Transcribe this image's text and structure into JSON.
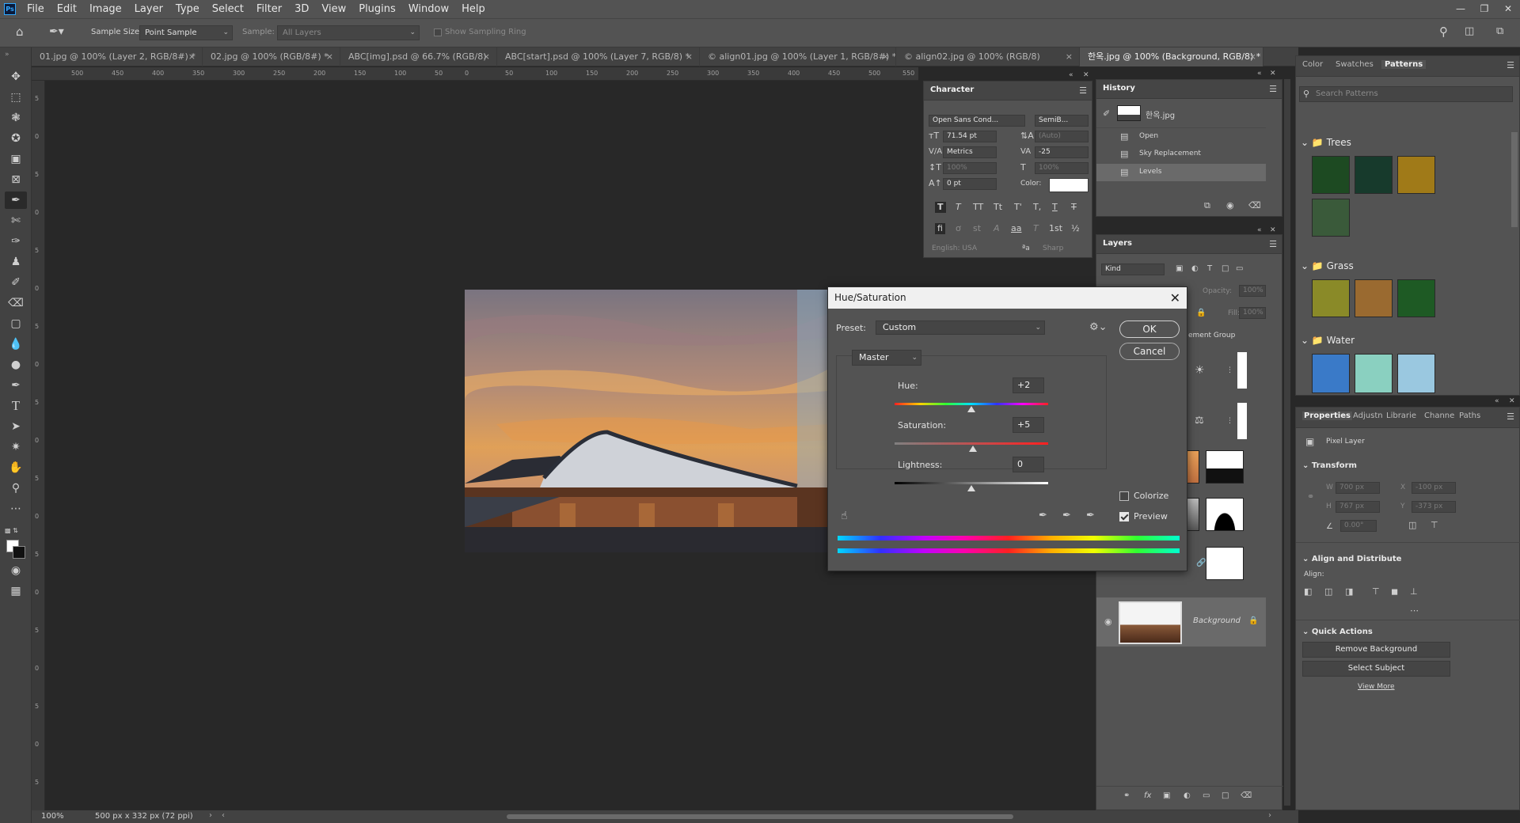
{
  "app": {
    "logo": "Ps",
    "menu": [
      "File",
      "Edit",
      "Image",
      "Layer",
      "Type",
      "Select",
      "Filter",
      "3D",
      "View",
      "Plugins",
      "Window",
      "Help"
    ]
  },
  "options": {
    "sample_size_label": "Sample Size:",
    "sample_size_value": "Point Sample",
    "sample_label": "Sample:",
    "sample_value": "All Layers",
    "show_ring": "Show Sampling Ring"
  },
  "tabs": [
    "01.jpg @ 100% (Layer 2, RGB/8#) *",
    "02.jpg @ 100% (RGB/8#) *",
    "ABC[img].psd @ 66.7% (RGB/8)",
    "ABC[start].psd @ 100% (Layer 7, RGB/8) *",
    "© align01.jpg @ 100% (Layer 1, RGB/8#) *",
    "© align02.jpg @ 100% (RGB/8)",
    "한옥.jpg @ 100% (Background, RGB/8) *"
  ],
  "ruler": {
    "h": [
      "500",
      "450",
      "400",
      "350",
      "300",
      "250",
      "200",
      "150",
      "100",
      "50",
      "0",
      "50",
      "100",
      "150",
      "200",
      "250",
      "300",
      "350",
      "400",
      "450",
      "500",
      "550"
    ],
    "v": [
      "5",
      "0",
      "5",
      "0",
      "5",
      "0",
      "5",
      "0",
      "5",
      "0",
      "5",
      "0",
      "5",
      "0",
      "5",
      "0",
      "5",
      "0",
      "5"
    ]
  },
  "status": {
    "zoom": "100%",
    "doc": "500 px x 332 px (72 ppi)"
  },
  "character": {
    "title": "Character",
    "font": "Open Sans Cond...",
    "style": "SemiB...",
    "size": "71.54 pt",
    "leading": "(Auto)",
    "kerning": "Metrics",
    "tracking": "-25",
    "vscale": "100%",
    "hscale": "100%",
    "baseline": "0 pt",
    "color_label": "Color:",
    "lang": "English: USA",
    "aa": "Sharp",
    "style_buttons": [
      "T",
      "T",
      "TT",
      "Tt",
      "T'",
      "T,",
      "T",
      "T"
    ],
    "ot_buttons": [
      "fi",
      "ơ",
      "st",
      "A",
      "aa",
      "T",
      "1st",
      "½"
    ]
  },
  "history": {
    "title": "History",
    "snapshot": "한옥.jpg",
    "items": [
      "Open",
      "Sky Replacement",
      "Levels"
    ]
  },
  "layers": {
    "title": "Layers",
    "kind": "Kind",
    "opacity_label": "Opacity:",
    "opacity": "100%",
    "fill_label": "Fill:",
    "fill": "100%",
    "group_name": "ement Group",
    "background": "Background"
  },
  "patterns": {
    "tabs": [
      "Color",
      "Swatches",
      "Patterns"
    ],
    "search": "Search Patterns",
    "groups": [
      {
        "name": "Trees",
        "colors": [
          "#1d4a22",
          "#173a2c",
          "#a07a18",
          "#3a5a3a"
        ]
      },
      {
        "name": "Grass",
        "colors": [
          "#8a8a28",
          "#9a6a30",
          "#1e5a24"
        ]
      },
      {
        "name": "Water",
        "colors": [
          "#3a7ac8",
          "#8ad0c0",
          "#9ac8e0"
        ]
      }
    ]
  },
  "properties": {
    "tabs": [
      "Properties",
      "Adjustn",
      "Librarie",
      "Channe",
      "Paths"
    ],
    "type": "Pixel Layer",
    "transform": "Transform",
    "w_label": "W",
    "w": "700 px",
    "h_label": "H",
    "h": "767 px",
    "x_label": "X",
    "x": "-100 px",
    "y_label": "Y",
    "y": "-373 px",
    "angle": "0.00°",
    "align_title": "Align and Distribute",
    "align_label": "Align:",
    "quick_title": "Quick Actions",
    "remove_bg": "Remove Background",
    "select_subject": "Select Subject",
    "view_more": "View More"
  },
  "dialog": {
    "title": "Hue/Saturation",
    "preset_label": "Preset:",
    "preset_value": "Custom",
    "ok": "OK",
    "cancel": "Cancel",
    "channel": "Master",
    "hue_label": "Hue:",
    "hue": "+2",
    "sat_label": "Saturation:",
    "sat": "+5",
    "light_label": "Lightness:",
    "light": "0",
    "colorize": "Colorize",
    "preview": "Preview",
    "colorize_checked": false,
    "preview_checked": true
  },
  "colors": {
    "accent": "#31a8ff",
    "panel": "#535353",
    "canvas": "#282828"
  }
}
